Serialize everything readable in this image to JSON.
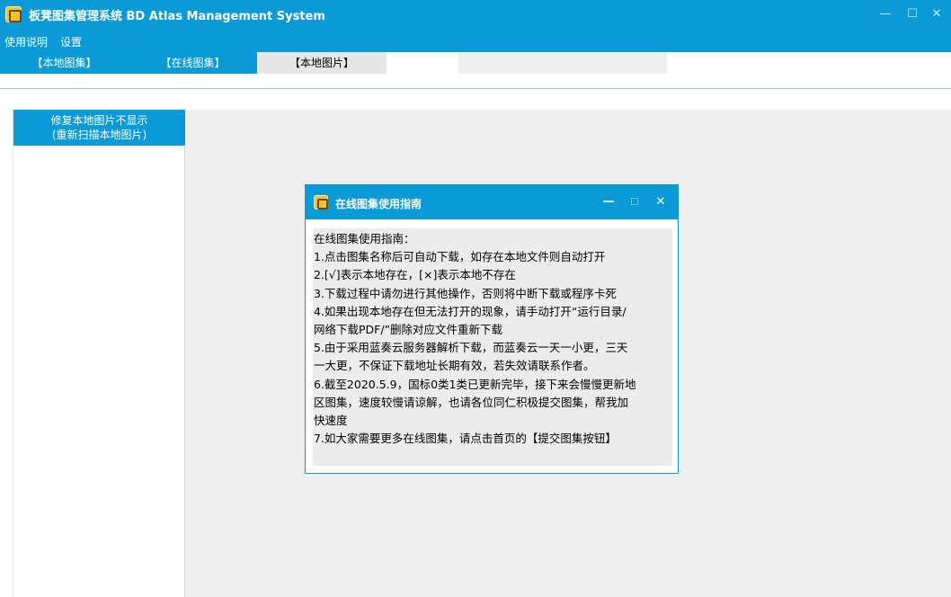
{
  "window": {
    "title": "板凳图集管理系统 BD Atlas Management System",
    "minimize_glyph": "—",
    "maximize_glyph": "☐",
    "close_glyph": "✕"
  },
  "menu": {
    "items": [
      "使用说明",
      "设置"
    ]
  },
  "tabs": [
    {
      "label": "【本地图集】",
      "active": false
    },
    {
      "label": "【在线图集】",
      "active": false
    },
    {
      "label": "【本地图片】",
      "active": true
    }
  ],
  "sidebar": {
    "repair_button": [
      "修复本地图片不显示",
      "(重新扫描本地图片)"
    ]
  },
  "dialog": {
    "title": "在线图集使用指南",
    "minimize_glyph": "—",
    "maximize_glyph": "☐",
    "close_glyph": "✕",
    "lines": [
      "在线图集使用指南：",
      "1.点击图集名称后可自动下载，如存在本地文件则自动打开",
      "2.[√]表示本地存在，[×]表示本地不存在",
      "3.下载过程中请勿进行其他操作，否则将中断下载或程序卡死",
      "4.如果出现本地存在但无法打开的现象，请手动打开“运行目录/",
      "网络下载PDF/”删除对应文件重新下载",
      "5.由于采用蓝奏云服务器解析下载，而蓝奏云一天一小更，三天",
      "一大更，不保证下载地址长期有效，若失效请联系作者。",
      "6.截至2020.5.9，国标0类1类已更新完毕，接下来会慢慢更新地",
      "区图集，速度较慢请谅解，也请各位同仁积极提交图集，帮我加",
      "快速度",
      "7.如大家需要更多在线图集，请点击首页的【提交图集按钮】"
    ]
  },
  "icons": {
    "app": "app-logo-icon",
    "dialog": "dialog-logo-icon"
  },
  "colors": {
    "accent": "#0a9ad8",
    "workspace": "#efefef",
    "dialog_body": "#ececec",
    "active_tab": "#e6e6e6"
  }
}
